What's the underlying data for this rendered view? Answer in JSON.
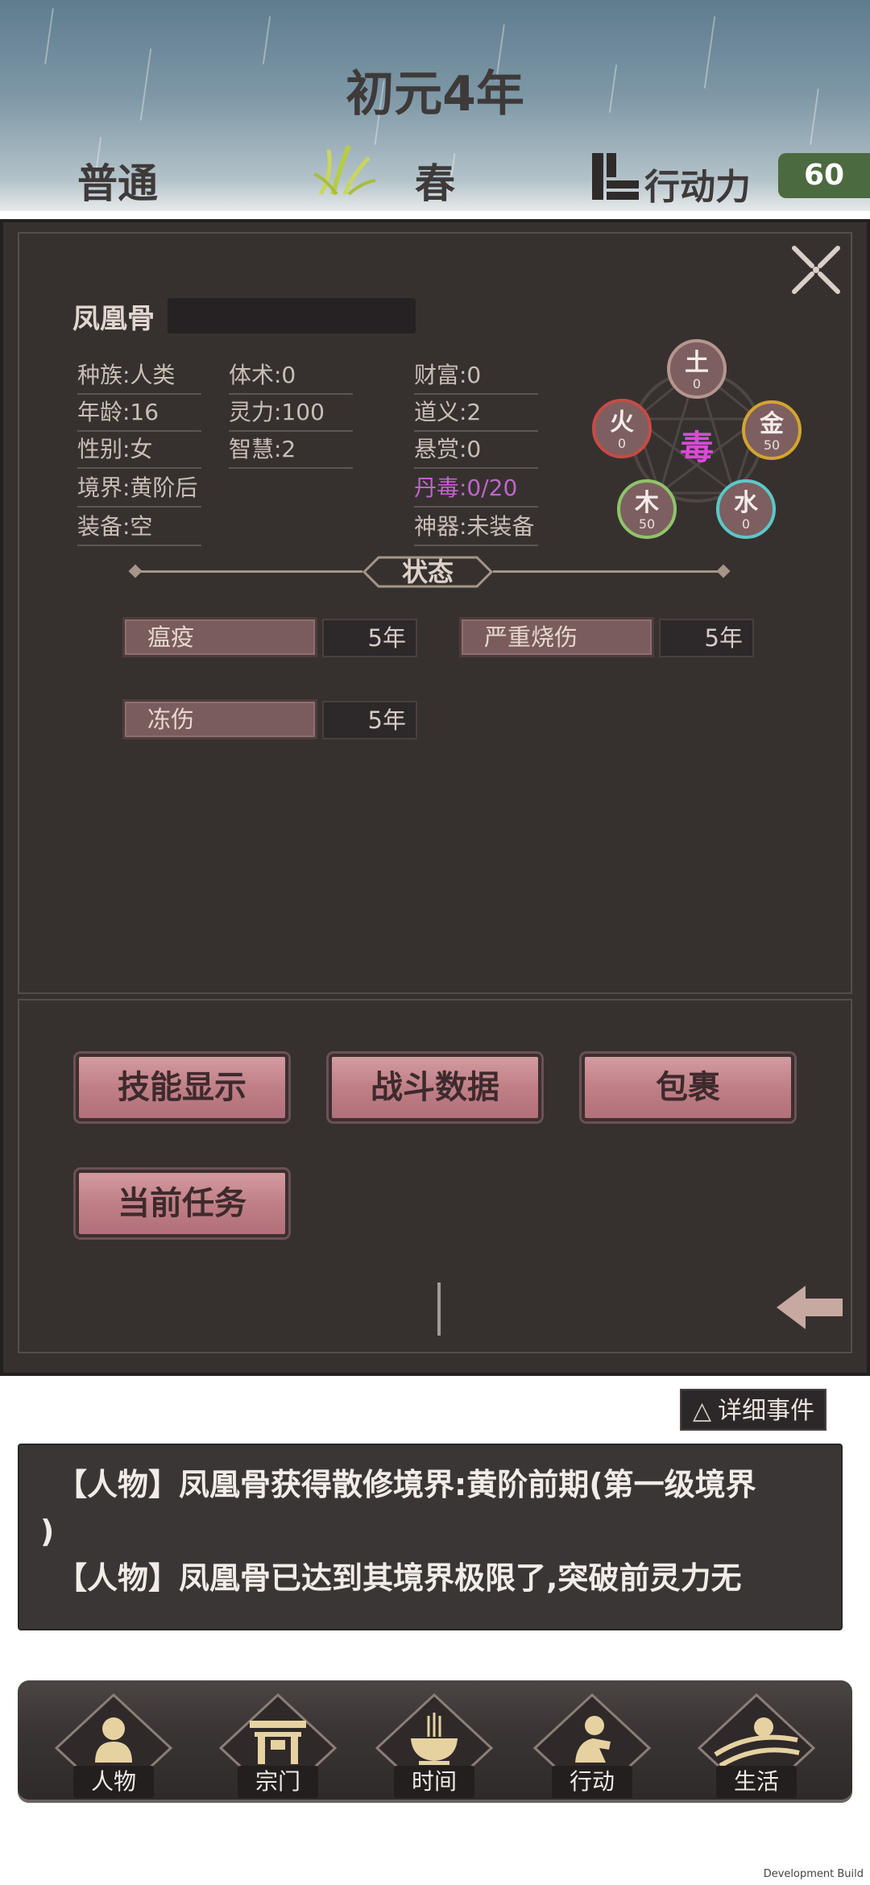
{
  "header": {
    "year": "初元4年",
    "difficulty": "普通",
    "season": "春",
    "action_power_label": "行动力",
    "action_power_value": "60"
  },
  "character": {
    "name": "凤凰骨",
    "stats_col1": [
      "种族:人类",
      "年龄:16",
      "性别:女",
      "境界:黄阶后",
      "装备:空"
    ],
    "stats_col2": [
      "体术:0",
      "灵力:100",
      "智慧:2"
    ],
    "stats_col3": [
      "财富:0",
      "道义:2",
      "悬赏:0",
      "丹毒:0/20",
      "神器:未装备"
    ]
  },
  "wuxing": {
    "center": "毒",
    "earth": {
      "label": "土",
      "value": "0"
    },
    "fire": {
      "label": "火",
      "value": "0"
    },
    "metal": {
      "label": "金",
      "value": "50"
    },
    "wood": {
      "label": "木",
      "value": "50"
    },
    "water": {
      "label": "水",
      "value": "0"
    }
  },
  "status": {
    "title": "状态",
    "items": [
      {
        "name": "瘟疫",
        "duration": "5年"
      },
      {
        "name": "严重烧伤",
        "duration": "5年"
      },
      {
        "name": "冻伤",
        "duration": "5年"
      }
    ]
  },
  "actions": {
    "skills": "技能显示",
    "battle_data": "战斗数据",
    "bag": "包裹",
    "current_task": "当前任务"
  },
  "events": {
    "detail_button": "详细事件",
    "detail_icon": "△",
    "lines": [
      "【人物】凤凰骨获得散修境界:黄阶前期(第一级境界",
      ")",
      "【人物】凤凰骨已达到其境界极限了,突破前灵力无"
    ]
  },
  "nav": {
    "character": "人物",
    "sect": "宗门",
    "time": "时间",
    "action": "行动",
    "life": "生活"
  },
  "footer": {
    "build": "Development Build"
  }
}
